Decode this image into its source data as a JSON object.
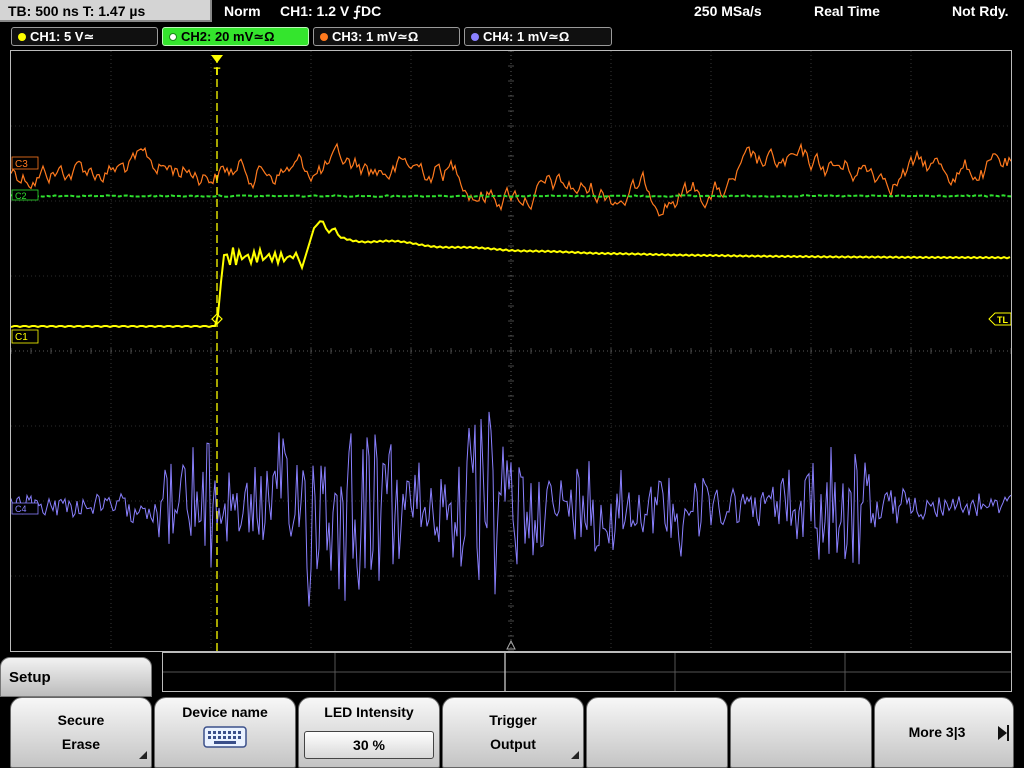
{
  "header": {
    "timebase": "TB: 500 ns   T: 1.47 µs",
    "mode": "Norm",
    "trigger": "CH1: 1.2 V ⨍DC",
    "sample_rate": "250 MSa/s",
    "acquisition": "Real Time",
    "status": "Not Rdy."
  },
  "channels": [
    {
      "label": "CH1: 5 V≃",
      "color": "#ffff00",
      "active": false
    },
    {
      "label": "CH2: 20 mV≃Ω",
      "color": "#2ee02e",
      "active": true
    },
    {
      "label": "CH3: 1 mV≃Ω",
      "color": "#ff7a1e",
      "active": false
    },
    {
      "label": "CH4: 1 mV≃Ω",
      "color": "#8a80ff",
      "active": false
    }
  ],
  "markers": {
    "c1": "C1",
    "c2": "C2",
    "c3": "C3",
    "c4": "C4",
    "trigger_level": "TL",
    "trigger_pos": "T"
  },
  "waveforms": {
    "ch1": {
      "pre_trigger_level_v": -1.2,
      "post_trigger_level_v": 3.3,
      "peak_v": 5.6
    },
    "ch2": {
      "level": "flat"
    },
    "ch3": {
      "noise": "random"
    },
    "ch4": {
      "noise": "burst"
    }
  },
  "menu": {
    "title": "Setup",
    "keys": [
      {
        "line1": "Secure",
        "line2": "Erase"
      },
      {
        "line1": "Device name",
        "icon": "keyboard-icon"
      },
      {
        "line1": "LED Intensity",
        "value": "30 %"
      },
      {
        "line1": "Trigger",
        "line2": "Output"
      },
      {
        "line1": ""
      },
      {
        "line1": ""
      },
      {
        "line1": "More 3|3"
      }
    ]
  },
  "colors": {
    "ch1": "#ffff00",
    "ch2": "#2ee02e",
    "ch3": "#ff7a1e",
    "ch4": "#8a80ff",
    "grid": "#5a5a5a"
  }
}
